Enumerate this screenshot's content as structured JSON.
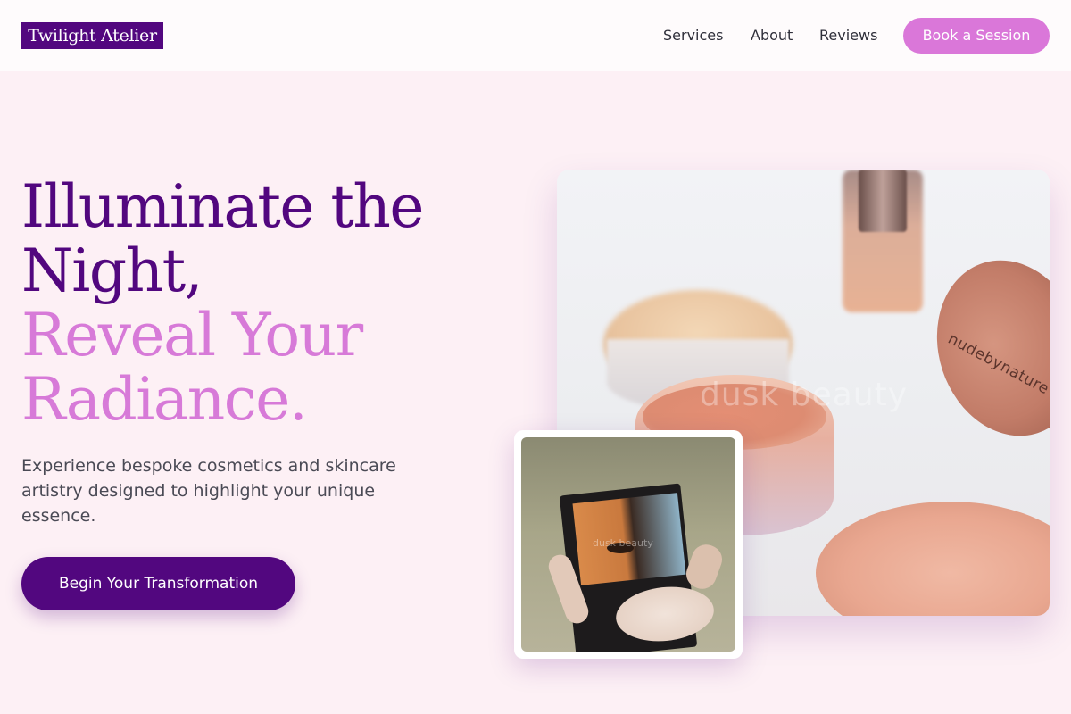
{
  "header": {
    "logo": "Twilight Atelier",
    "nav": {
      "services": "Services",
      "about": "About",
      "reviews": "Reviews"
    },
    "book_button": "Book a Session"
  },
  "hero": {
    "title_lines": [
      "Illuminate the",
      "Night,"
    ],
    "title_accent_lines": [
      "Reveal Your",
      "Radiance."
    ],
    "subtitle": "Experience bespoke cosmetics and skincare artistry designed to highlight your unique essence.",
    "cta": "Begin Your Transformation"
  },
  "images": {
    "main_lid_text": "nudebynature",
    "main_watermark": "dusk beauty",
    "inset_watermark": "dusk beauty"
  },
  "colors": {
    "brand": "#52077f",
    "accent": "#da77d9",
    "background": "#fdf0f5"
  }
}
